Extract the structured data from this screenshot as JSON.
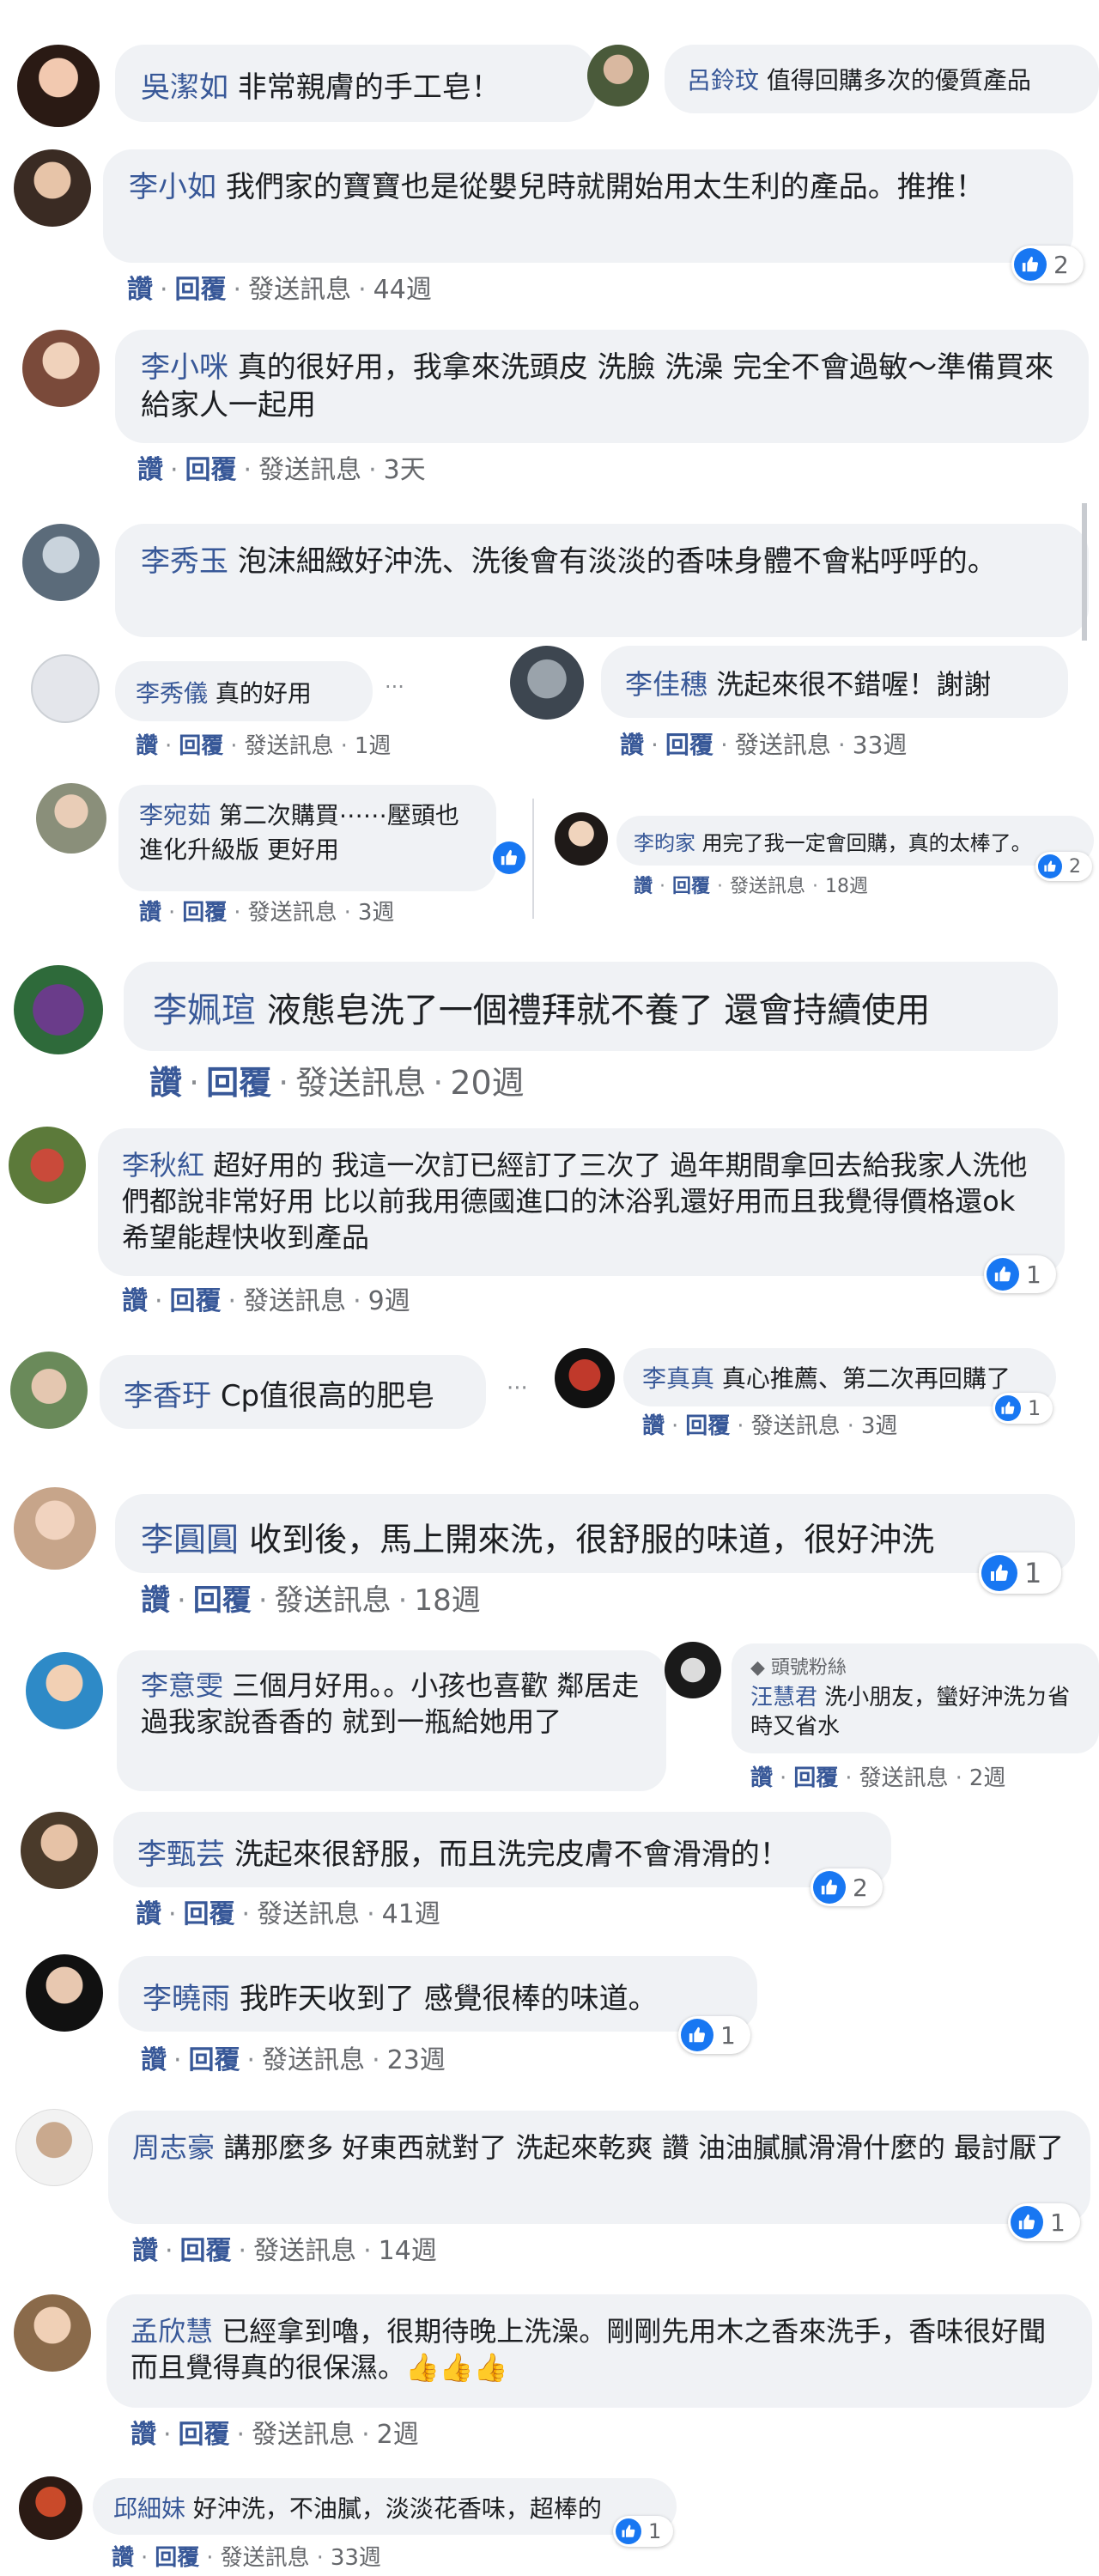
{
  "comments": [
    {
      "name": "吳潔如",
      "text": "非常親膚的手工皂！"
    },
    {
      "name": "呂鈴玟",
      "text": "值得回購多次的優質產品"
    },
    {
      "name": "李小如",
      "text": "我們家的寶寶也是從嬰兒時就開始用太生利的產品。推推！",
      "time": "44週",
      "likes": "2"
    },
    {
      "name": "李小咪",
      "text": "真的很好用，我拿來洗頭皮 洗臉 洗澡 完全不會過敏～準備買來給家人一起用",
      "time": "3天"
    },
    {
      "name": "李秀玉",
      "text": "泡沫細緻好沖洗、洗後會有淡淡的香味身體不會粘呼呼的。"
    },
    {
      "name": "李秀儀",
      "text": "真的好用",
      "time": "1週"
    },
    {
      "name": "李佳穗",
      "text": "洗起來很不錯喔！謝謝",
      "time": "33週"
    },
    {
      "name": "李宛茹",
      "text": "第二次購買⋯⋯壓頭也進化升級版 更好用",
      "time": "3週"
    },
    {
      "name": "李昀家",
      "text": "用完了我一定會回購，真的太棒了。",
      "time": "18週",
      "likes": "2"
    },
    {
      "name": "李姵瑄",
      "text": "液態皂洗了一個禮拜就不養了 還會持續使用",
      "time": "20週"
    },
    {
      "name": "李秋紅",
      "text": "超好用的 我這一次訂已經訂了三次了 過年期間拿回去給我家人洗他們都說非常好用 比以前我用德國進口的沐浴乳還好用而且我覺得價格還ok 希望能趕快收到產品",
      "time": "9週",
      "likes": "1"
    },
    {
      "name": "李香玗",
      "text": "Cp值很高的肥皂"
    },
    {
      "name": "李真真",
      "text": "真心推薦、第二次再回購了",
      "time": "3週",
      "likes": "1"
    },
    {
      "name": "李圓圓",
      "text": "收到後，馬上開來洗，很舒服的味道，很好沖洗",
      "time": "18週",
      "likes": "1"
    },
    {
      "name": "李意雯",
      "text": "三個月好用。。小孩也喜歡 鄰居走過我家說香香的 就到一瓶給她用了"
    },
    {
      "name": "汪慧君",
      "badge": "頭號粉絲",
      "text": "洗小朋友，蠻好沖洗ㄉ省時又省水",
      "time": "2週"
    },
    {
      "name": "李甄芸",
      "text": "洗起來很舒服，而且洗完皮膚不會滑滑的！",
      "time": "41週",
      "likes": "2"
    },
    {
      "name": "李曉雨",
      "text": "我昨天收到了 感覺很棒的味道。",
      "time": "23週",
      "likes": "1"
    },
    {
      "name": "周志豪",
      "text": "講那麼多 好東西就對了 洗起來乾爽 讚 油油膩膩滑滑什麼的 最討厭了",
      "time": "14週",
      "likes": "1"
    },
    {
      "name": "孟欣慧",
      "text": "已經拿到嚕，很期待晚上洗澡。剛剛先用木之香來洗手，香味很好聞而且覺得真的很保濕。👍👍👍",
      "time": "2週"
    },
    {
      "name": "邱細妹",
      "text": "好沖洗，不油膩，淡淡花香味，超棒的",
      "time": "33週",
      "likes": "1"
    }
  ],
  "actions": {
    "like": "讚",
    "reply": "回覆",
    "message": "發送訊息",
    "sep": "·"
  },
  "more": "···",
  "colors": {
    "name": "#385898",
    "bubble": "#f0f2f5",
    "like_blue": "#1877f2",
    "meta": "#65676b"
  }
}
